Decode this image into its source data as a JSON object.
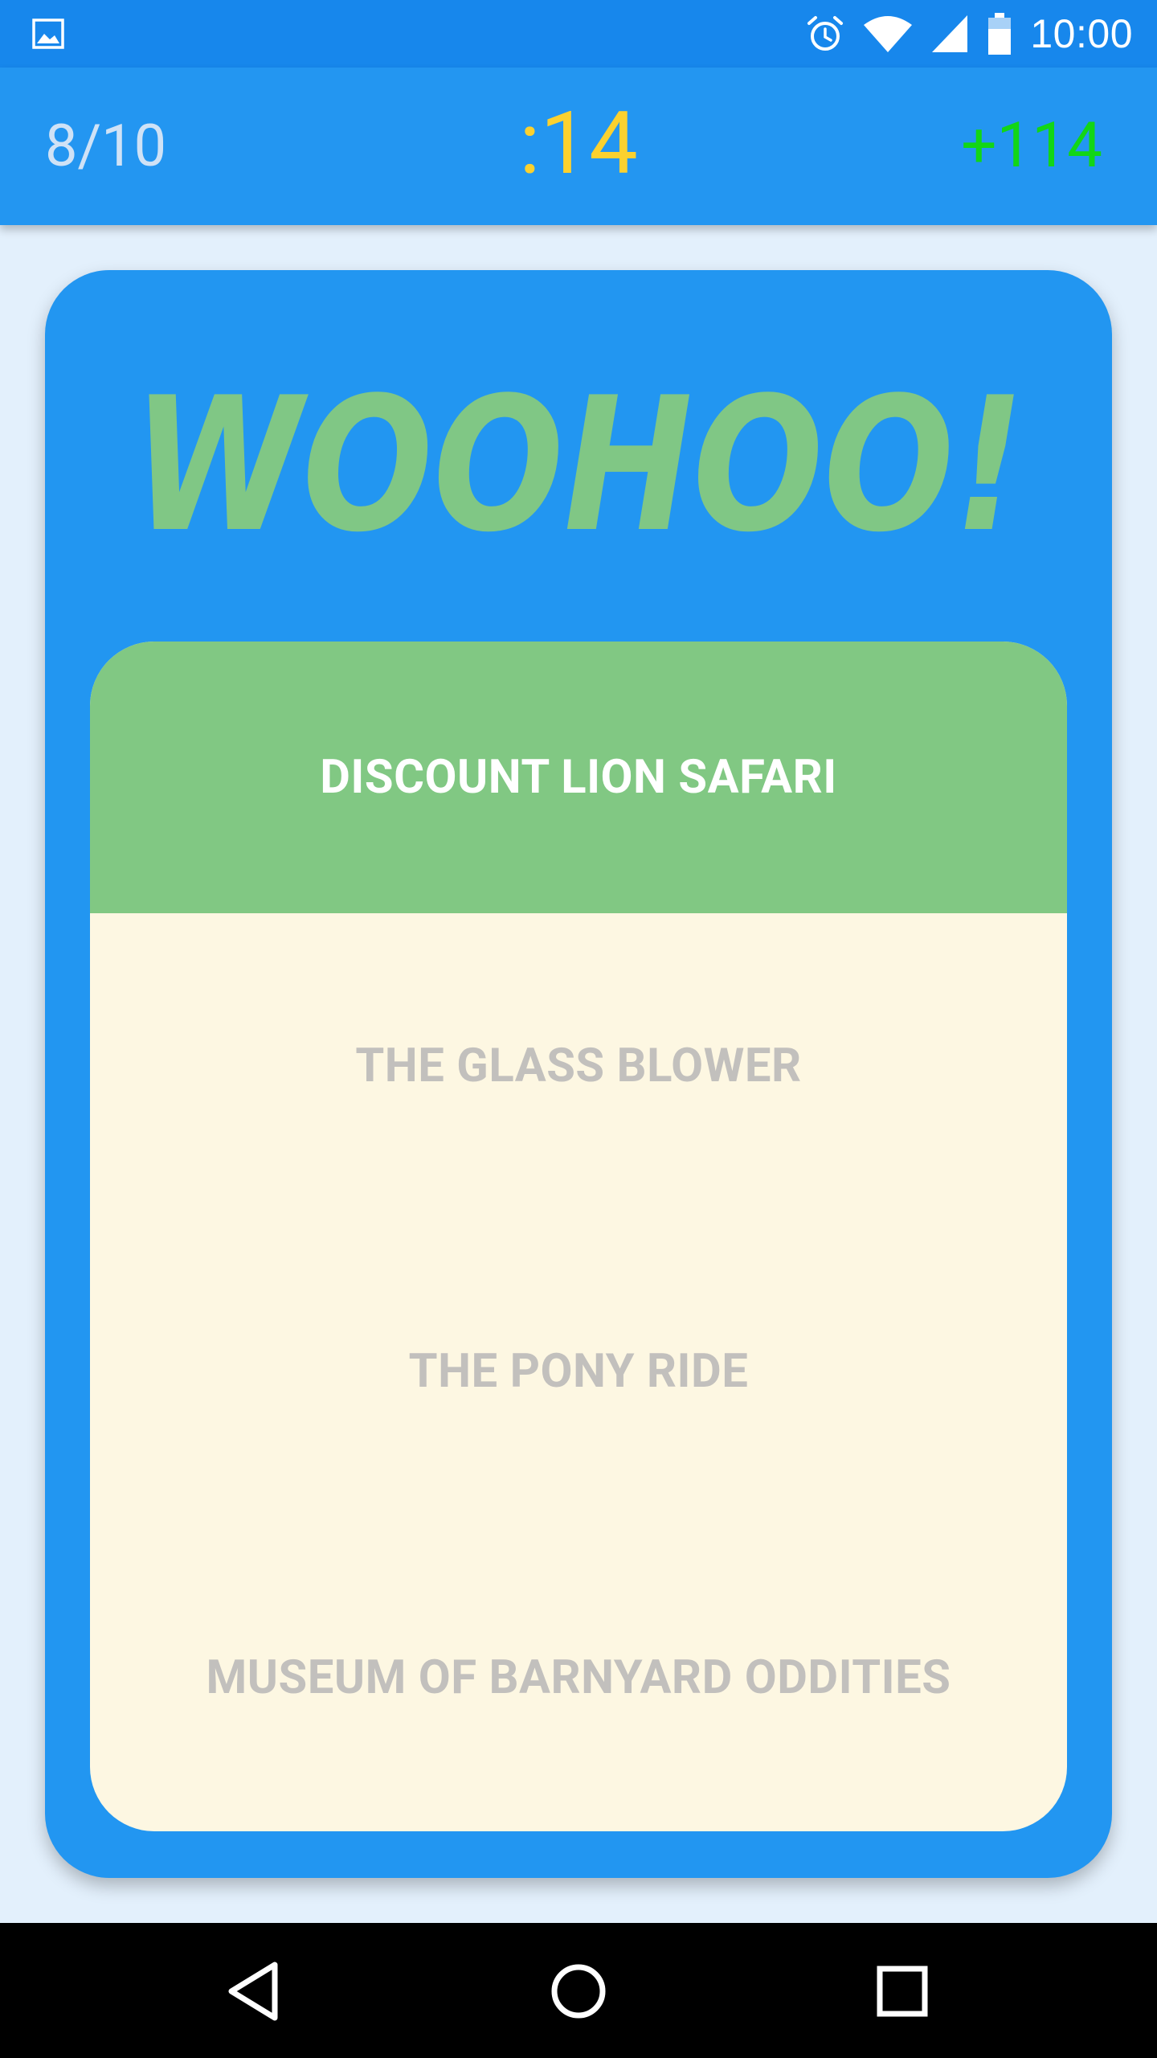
{
  "status_bar": {
    "time": "10:00",
    "icons": [
      "image-notification-icon",
      "alarm-icon",
      "wifi-icon",
      "cell-signal-icon",
      "battery-icon"
    ]
  },
  "header": {
    "progress": "8/10",
    "timer": ":14",
    "score": "+114"
  },
  "card": {
    "banner": "WOOHOO!",
    "options": [
      {
        "label": "DISCOUNT LION SAFARI",
        "state": "correct"
      },
      {
        "label": "THE GLASS BLOWER",
        "state": "dimmed"
      },
      {
        "label": "THE PONY RIDE",
        "state": "dimmed"
      },
      {
        "label": "MUSEUM OF BARNYARD ODDITIES",
        "state": "dimmed"
      }
    ]
  },
  "nav_bar": {
    "buttons": [
      "back-icon",
      "home-icon",
      "recents-icon"
    ]
  },
  "colors": {
    "status_bar": "#1787ec",
    "app_bar": "#2396f1",
    "card": "#2296f1",
    "correct": "#81c883",
    "options_bg": "#fdf7e2",
    "timer": "#fbd12f",
    "score": "#12d616",
    "banner_text": "#80c785"
  }
}
